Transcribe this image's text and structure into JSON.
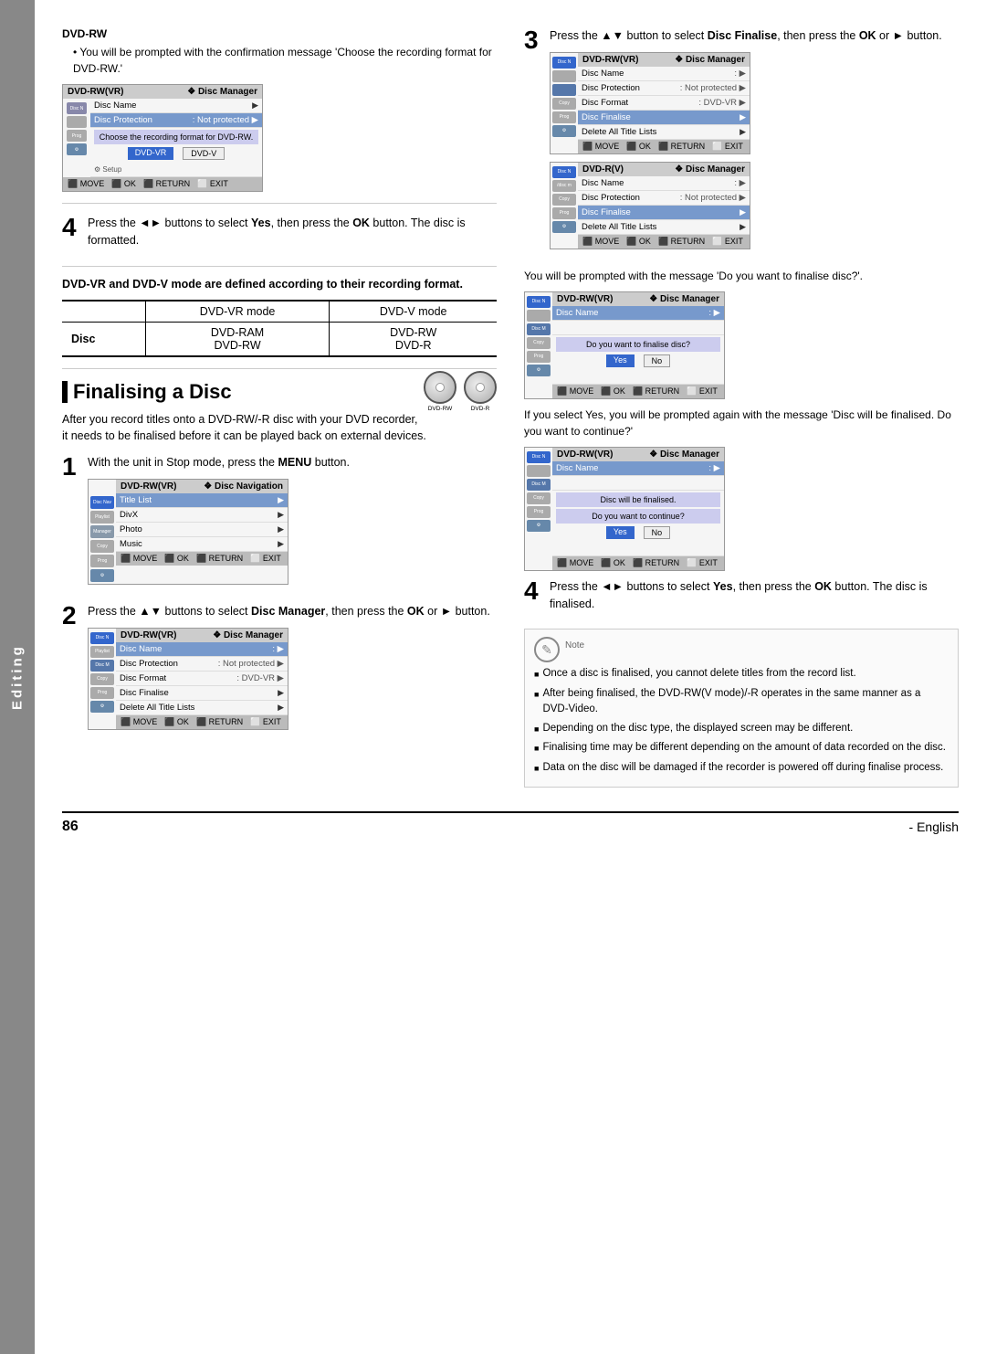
{
  "page": {
    "side_tab": "Editing",
    "page_number": "86",
    "language": "English"
  },
  "left_col": {
    "top_section": {
      "label": "DVD-RW",
      "bullet": "You will be prompted with the confirmation message 'Choose the recording format for DVD-RW.'"
    },
    "screen1": {
      "header_left": "DVD-RW(VR)",
      "header_right": "❖ Disc Manager",
      "rows": [
        {
          "label": "Disc Navigation",
          "value": "Disc Name",
          "sym": ":",
          "arrow": "▶",
          "highlight": false
        },
        {
          "label": "",
          "value": "Disc Protection",
          "sym": ": Not protected",
          "arrow": "▶",
          "highlight": true
        },
        {
          "label": "Disc M",
          "value": "",
          "sym": "",
          "arrow": "",
          "highlight": false
        },
        {
          "label": "",
          "value": "Choose the recording format for DVD-RW.",
          "sym": "",
          "arrow": "",
          "highlight": false,
          "msg": true
        }
      ],
      "buttons": [
        "DVD-VR",
        "DVD-V"
      ],
      "footer": [
        "MOVE",
        "OK",
        "RETURN",
        "EXIT"
      ]
    },
    "step4_left": {
      "number": "4",
      "text": "Press the ◄► buttons to select ",
      "bold": "Yes",
      "text2": ", then press the ",
      "bold2": "OK",
      "text3": " button. The disc is formatted."
    },
    "mode_table": {
      "bold_note": "DVD-VR and DVD-V mode are defined according to their recording format.",
      "headers": [
        "",
        "DVD-VR mode",
        "DVD-V mode"
      ],
      "rows": [
        {
          "label": "Disc",
          "col1": "DVD-RAM\nDVD-RW",
          "col2": "DVD-RW\nDVD-R"
        }
      ]
    },
    "section": {
      "title": "Finalising a Disc",
      "intro": "After you record titles onto a DVD-RW/-R disc with your DVD recorder, it needs to be finalised before it can be played back on external devices.",
      "disc_icons": [
        {
          "label": "DVD-RW"
        },
        {
          "label": "DVD-R"
        }
      ]
    },
    "step1": {
      "number": "1",
      "text": "With the unit in Stop mode, press the ",
      "bold": "MENU",
      "text2": " button."
    },
    "screen_step1": {
      "header_left": "DVD-RW(VR)",
      "header_right": "❖ Disc Navigation",
      "rows": [
        {
          "label": "Disc Navigation",
          "value": "Title List",
          "arrow": "▶",
          "highlight": true
        },
        {
          "label": "",
          "value": "DivX",
          "arrow": "▶"
        },
        {
          "label": "",
          "value": "Photo",
          "arrow": "▶"
        },
        {
          "label": "",
          "value": "Music",
          "arrow": "▶"
        }
      ],
      "side_icons": [
        "Playlist",
        "Manager",
        "Copy",
        "Programme",
        "Setup"
      ],
      "footer": [
        "MOVE",
        "OK",
        "RETURN",
        "EXIT"
      ]
    },
    "step2": {
      "number": "2",
      "text": "Press the ▲▼ buttons to select ",
      "bold": "Disc Manager",
      "text2": ", then press the ",
      "bold2": "OK",
      "text3": " or ► button."
    },
    "screen_step2": {
      "header_left": "DVD-RW(VR)",
      "header_right": "❖ Disc Manager",
      "rows": [
        {
          "label": "Disc Navigation",
          "value": "Disc Name",
          "sym": ":",
          "arrow": "▶",
          "highlight": true
        },
        {
          "label": "Playlist",
          "value": "Disc Protection",
          "sym": ": Not protected",
          "arrow": "▶"
        },
        {
          "label": "Disc Manager",
          "value": "Disc Format",
          "sym": ": DVD-VR",
          "arrow": "▶"
        },
        {
          "label": "",
          "value": "Disc Finalise",
          "arrow": "▶"
        },
        {
          "label": "Copy",
          "value": "Delete All Title Lists",
          "arrow": "▶"
        },
        {
          "label": "Programme",
          "value": "",
          "arrow": ""
        },
        {
          "label": "Setup",
          "value": "",
          "arrow": ""
        }
      ],
      "footer": [
        "MOVE",
        "OK",
        "RETURN",
        "EXIT"
      ]
    }
  },
  "right_col": {
    "step3": {
      "number": "3",
      "text": "Press the ▲▼ button to select ",
      "bold": "Disc Finalise",
      "text2": ", then press the ",
      "bold2": "OK",
      "text3": " or ► button."
    },
    "screen_step3a": {
      "header_left": "DVD-RW(VR)",
      "header_right": "❖ Disc Manager",
      "rows": [
        {
          "label": "Disc Navigation",
          "value": "Disc Name",
          "sym": ":",
          "arrow": "▶",
          "highlight": false
        },
        {
          "label": "",
          "value": "Disc Protection",
          "sym": ": Not protected",
          "arrow": "▶"
        },
        {
          "label": "",
          "value": "Disc Format",
          "sym": ": DVD-VR",
          "arrow": "▶"
        },
        {
          "label": "",
          "value": "Disc Finalise",
          "arrow": "▶",
          "highlight": true
        },
        {
          "label": "Copy",
          "value": "Delete All Title Lists",
          "arrow": "▶"
        },
        {
          "label": "Programme",
          "value": ""
        },
        {
          "label": "Setup",
          "value": ""
        }
      ],
      "footer": [
        "MOVE",
        "OK",
        "RETURN",
        "EXIT"
      ]
    },
    "screen_step3b": {
      "header_left": "DVD-R(V)",
      "header_right": "❖ Disc Manager",
      "rows": [
        {
          "label": "Disc Navigation",
          "value": "Disc Name",
          "sym": ":",
          "arrow": "▶"
        },
        {
          "label": "/disc manager",
          "value": "Disc Protection",
          "sym": ": Not protected",
          "arrow": "▶"
        },
        {
          "label": "",
          "value": "Disc Finalise",
          "arrow": "▶",
          "highlight": true
        },
        {
          "label": "Copy",
          "value": "Delete All Title Lists",
          "arrow": "▶"
        },
        {
          "label": "Programme",
          "value": ""
        },
        {
          "label": "Setup",
          "value": ""
        }
      ],
      "footer": [
        "MOVE",
        "OK",
        "RETURN",
        "EXIT"
      ]
    },
    "between_text": "You will be prompted with the message 'Do you want to finalise disc?'.",
    "screen_finalise_q": {
      "header_left": "DVD-RW(VR)",
      "header_right": "❖ Disc Manager",
      "disc_name_row": {
        "label": "Disc Navigation",
        "value": "Disc Name",
        "sym": ":",
        "arrow": "▶"
      },
      "msg": "Do you want to finalise disc?",
      "buttons": [
        "Yes",
        "No"
      ],
      "footer": [
        "MOVE",
        "OK",
        "RETURN",
        "EXIT"
      ]
    },
    "if_yes_text": "If you select Yes, you will be prompted again with the message 'Disc will be finalised. Do you want to continue?'",
    "screen_continue_q": {
      "header_left": "DVD-RW(VR)",
      "header_right": "❖ Disc Manager",
      "disc_name_row": {
        "label": "Disc Navigation",
        "value": "Disc Name",
        "sym": ":",
        "arrow": "▶"
      },
      "msg1": "Disc will be finalised.",
      "msg2": "Do you want to continue?",
      "buttons": [
        "Yes",
        "No"
      ],
      "footer": [
        "MOVE",
        "OK",
        "RETURN",
        "EXIT"
      ]
    },
    "step4_right": {
      "number": "4",
      "text": "Press the ◄► buttons to select ",
      "bold": "Yes",
      "text2": ", then press the ",
      "bold2": "OK",
      "text3": " button. The disc is finalised."
    },
    "note": {
      "items": [
        "Once a disc is finalised, you cannot delete titles from the record list.",
        "After being finalised, the DVD-RW(V mode)/-R operates in the same manner as a DVD-Video.",
        "Depending on the disc type, the displayed screen may be different.",
        "Finalising time may be different depending on the amount of data recorded on the disc.",
        "Data on the disc will be damaged if the recorder is powered off during finalise process."
      ],
      "label": "Note"
    },
    "press_the": "Press the"
  }
}
